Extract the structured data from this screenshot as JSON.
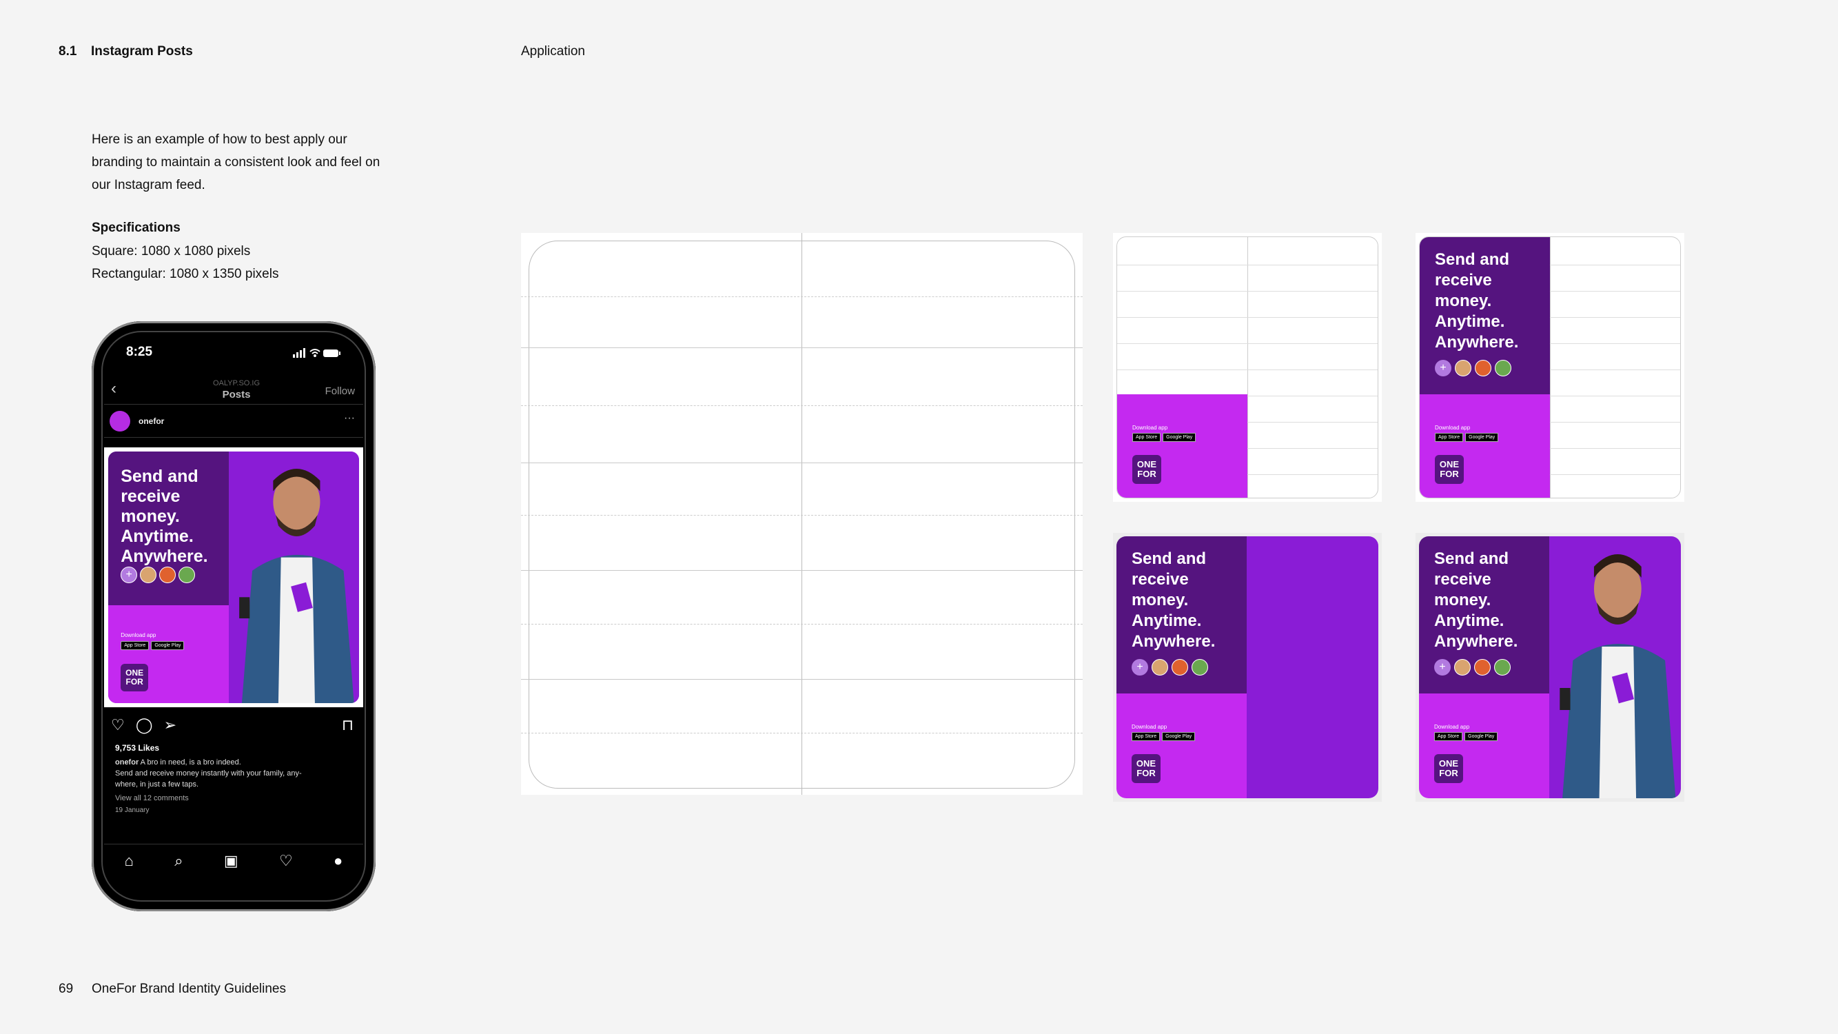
{
  "header": {
    "section_number": "8.1",
    "section_title": "Instagram Posts",
    "app_label": "Application"
  },
  "intro": {
    "text": "Here is an example of how to best apply our branding to maintain a consistent look and feel on our Instagram feed."
  },
  "specs": {
    "title": "Specifications",
    "square": "Square: 1080 x 1080 pixels",
    "rect": "Rectangular: 1080 x 1350 pixels"
  },
  "footer": {
    "page": "69",
    "title": "OneFor Brand Identity Guidelines"
  },
  "phone": {
    "time": "8:25",
    "status_icons": "signal-icon wifi-icon battery-icon",
    "back": "‹",
    "account_sub": "OALYP.SO.IG",
    "account_title": "Posts",
    "follow": "Follow",
    "username": "onefor",
    "more": "···",
    "likes": "9,753 Likes",
    "caption_user": "onefor",
    "caption_text": " A bro in need, is a bro indeed.",
    "caption_line2": "Send and receive money instantly with your family, any-",
    "caption_line3": "where, in just a few taps.",
    "comments": "View all 12 comments",
    "date": "19 January"
  },
  "post": {
    "headline": "Send and receive money. Anytime. Anywhere.",
    "download": "Download app",
    "badge_app_store": "App Store",
    "badge_google_play": "Google Play",
    "logo_line1": "ONE",
    "logo_line2": "FOR",
    "plus": "+"
  },
  "colors": {
    "dark_purple": "#55147f",
    "magenta": "#c429f0",
    "violet": "#8a1cd6",
    "background": "#f4f4f4"
  }
}
